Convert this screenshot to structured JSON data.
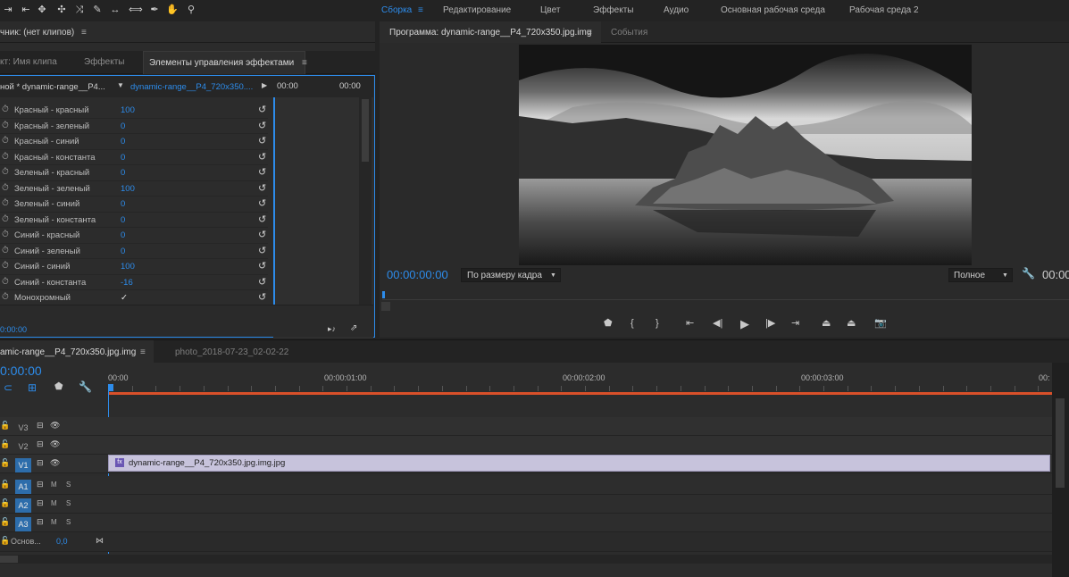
{
  "workspaces": {
    "assembly": "Сборка",
    "editing": "Редактирование",
    "color": "Цвет",
    "effects": "Эффекты",
    "audio": "Аудио",
    "main": "Основная рабочая среда",
    "ws2": "Рабочая среда 2",
    "menu_glyph": "≡"
  },
  "source_panel": {
    "title": "чник: (нет клипов)",
    "menu_glyph": "≡",
    "tabs": [
      "кт: Имя клипа",
      "Эффекты",
      "Элементы управления эффектами"
    ],
    "master_clip": "ной * dynamic-range__P4...",
    "sequence_clip": "dynamic-range__P4_720x350....",
    "time_start": "00:00",
    "time_end": "00:00",
    "bottom_time": "0:00:00"
  },
  "params": [
    {
      "name": "Красный - красный",
      "value": "100"
    },
    {
      "name": "Красный - зеленый",
      "value": "0"
    },
    {
      "name": "Красный - синий",
      "value": "0"
    },
    {
      "name": "Красный - константа",
      "value": "0"
    },
    {
      "name": "Зеленый - красный",
      "value": "0"
    },
    {
      "name": "Зеленый - зеленый",
      "value": "100"
    },
    {
      "name": "Зеленый - синий",
      "value": "0"
    },
    {
      "name": "Зеленый - константа",
      "value": "0"
    },
    {
      "name": "Синий - красный",
      "value": "0"
    },
    {
      "name": "Синий - зеленый",
      "value": "0"
    },
    {
      "name": "Синий - синий",
      "value": "100"
    },
    {
      "name": "Синий - константа",
      "value": "-16"
    },
    {
      "name": "Монохромный",
      "value": "✓"
    }
  ],
  "program": {
    "tab": "Программа: dynamic-range__P4_720x350.jpg.img",
    "menu_glyph": "≡",
    "events_tab": "События",
    "timecode": "00:00:00:00",
    "fit": "По размеру кадра",
    "quality": "Полное",
    "right_timecode": "00:00"
  },
  "timeline": {
    "tab1": "amic-range__P4_720x350.jpg.img",
    "tab2": "photo_2018-07-23_02-02-22",
    "menu_glyph": "≡",
    "timecode": "0:00:00",
    "ruler": [
      "00:00",
      "00:00:01:00",
      "00:00:02:00",
      "00:00:03:00",
      "00:"
    ],
    "tracks_video": [
      "V3",
      "V2",
      "V1"
    ],
    "tracks_audio": [
      "A1",
      "A2",
      "A3"
    ],
    "master_label": "Основ...",
    "master_value": "0,0",
    "clip_name": "dynamic-range__P4_720x350.jpg.img.jpg",
    "clip_fx": "fx",
    "m_label": "M",
    "s_label": "S"
  },
  "colors": {
    "accent": "#2d8ceb",
    "playhead": "#d9502a",
    "clip": "#c7c3dc"
  }
}
